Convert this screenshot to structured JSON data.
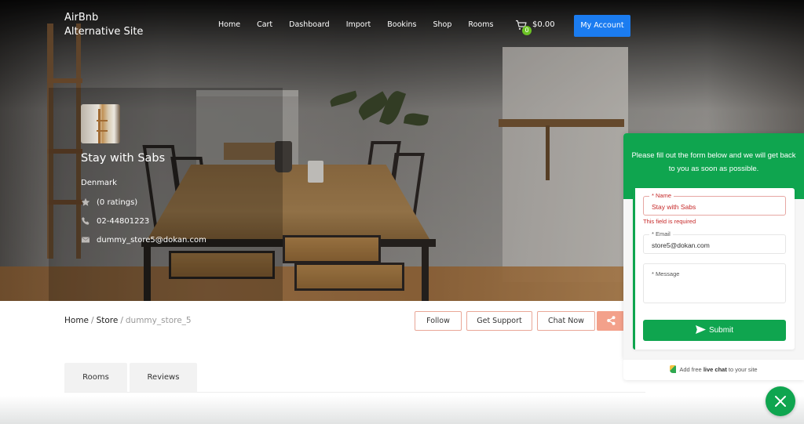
{
  "header": {
    "logo_line1": "AirBnb",
    "logo_line2": "Alternative Site",
    "nav": [
      {
        "label": "Home"
      },
      {
        "label": "Cart"
      },
      {
        "label": "Dashboard"
      },
      {
        "label": "Import"
      },
      {
        "label": "Bookins"
      },
      {
        "label": "Shop"
      },
      {
        "label": "Rooms"
      }
    ],
    "cart_icon": "cart-icon",
    "cart_count": "0",
    "cart_total": "$0.00",
    "account_label": "My Account",
    "colors": {
      "account_button": "#1b7cf0",
      "cart_badge": "#6cc325"
    }
  },
  "store": {
    "name": "Stay with Sabs",
    "country": "Denmark",
    "rating_text": "(0 ratings)",
    "phone": "02-44801223",
    "email": "dummy_store5@dokan.com",
    "icons": {
      "rating": "star-icon",
      "phone": "phone-icon",
      "email": "envelope-icon"
    }
  },
  "breadcrumb": {
    "items": [
      "Home",
      "Store"
    ],
    "separator": "/",
    "current": "dummy_store_5"
  },
  "actions": {
    "follow": "Follow",
    "support": "Get Support",
    "chat": "Chat Now",
    "share_icon": "share-icon",
    "colors": {
      "border": "#e9a797",
      "share_bg": "#f3a18b"
    }
  },
  "tabs": [
    {
      "label": "Rooms"
    },
    {
      "label": "Reviews"
    }
  ],
  "chat_widget": {
    "message": "Please fill out the form below and we will get back to you as soon as possible.",
    "fields": {
      "name": {
        "label": "* Name",
        "value": "Stay with Sabs",
        "error": "This field is required"
      },
      "email": {
        "label": "* Email",
        "value": "store5@dokan.com"
      },
      "message": {
        "placeholder": "* Message",
        "value": ""
      }
    },
    "submit_label": "Submit",
    "footer_pre": "Add free ",
    "footer_bold": "live chat",
    "footer_post": " to your site",
    "close_icon": "close-icon",
    "colors": {
      "primary": "#0fa54f",
      "error": "#c62828"
    }
  }
}
